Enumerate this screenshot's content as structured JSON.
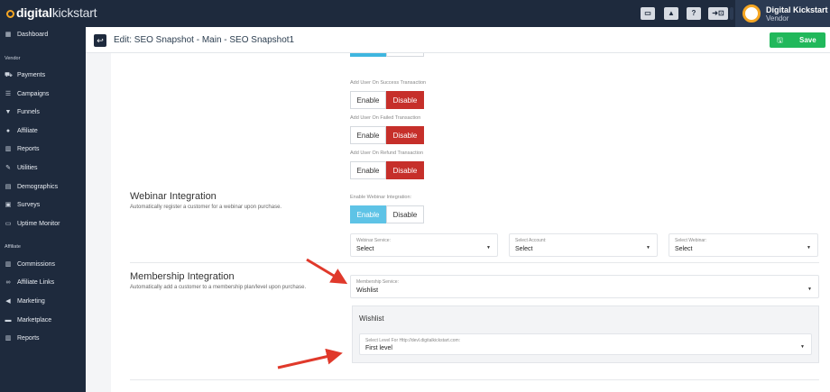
{
  "brand": {
    "logo_bold": "digital",
    "logo_light": "kickstart"
  },
  "topbar": {
    "buttons": [
      "▭",
      "▲",
      "?",
      "➜⊡",
      "●+"
    ],
    "user_name": "Digital Kickstart",
    "user_role": "Vendor"
  },
  "sidebar": {
    "top": [
      {
        "label": "Dashboard",
        "icon": "grid-icon"
      }
    ],
    "vendor_section": "Vendor",
    "vendor_items": [
      {
        "label": "Payments",
        "icon": "cart-icon"
      },
      {
        "label": "Campaigns",
        "icon": "list-icon"
      },
      {
        "label": "Funnels",
        "icon": "filter-icon"
      },
      {
        "label": "Affiliate",
        "icon": "user-icon"
      },
      {
        "label": "Reports",
        "icon": "bar-chart-icon"
      },
      {
        "label": "Utilities",
        "icon": "wrench-icon"
      },
      {
        "label": "Demographics",
        "icon": "area-chart-icon"
      },
      {
        "label": "Surveys",
        "icon": "clipboard-icon"
      },
      {
        "label": "Uptime Monitor",
        "icon": "monitor-icon"
      }
    ],
    "affiliate_section": "Affiliate",
    "affiliate_items": [
      {
        "label": "Commissions",
        "icon": "bar-chart-icon"
      },
      {
        "label": "Affiliate Links",
        "icon": "link-icon"
      },
      {
        "label": "Marketing",
        "icon": "megaphone-icon"
      },
      {
        "label": "Marketplace",
        "icon": "store-icon"
      },
      {
        "label": "Reports",
        "icon": "bar-chart-icon"
      }
    ]
  },
  "header": {
    "title": "Edit: SEO Snapshot - Main - SEO Snapshot1",
    "save_label": "Save",
    "back_icon": "↩",
    "save_icon": "🖫"
  },
  "toggles": [
    {
      "label": "Add User On Success Transaction",
      "enable": "Enable",
      "disable": "Disable",
      "selected": "disable"
    },
    {
      "label": "Add User On Failed Transaction",
      "enable": "Enable",
      "disable": "Disable",
      "selected": "disable"
    },
    {
      "label": "Add User On Refund Transaction",
      "enable": "Enable",
      "disable": "Disable",
      "selected": "disable"
    }
  ],
  "webinar": {
    "title": "Webinar Integration",
    "description": "Automatically register a customer for a webinar upon purchase.",
    "enable_label": "Enable Webinar Integration:",
    "enable": "Enable",
    "disable": "Disable",
    "selected": "enable",
    "service_label": "Webinar Service:",
    "service_value": "Select",
    "account_label": "Select Account:",
    "account_value": "Select",
    "select_webinar_label": "Select Webinar:",
    "select_webinar_value": "Select"
  },
  "membership": {
    "title": "Membership Integration",
    "description": "Automatically add a customer to a membership plan/level upon purchase.",
    "service_label": "Membership Service:",
    "service_value": "Wishlist",
    "box_title": "Wishlist",
    "level_label": "Select Level For Http://devl.digitalkickstart.com:",
    "level_value": "First level"
  },
  "colors": {
    "sidebar": "#1e2a3d",
    "save": "#21b85b",
    "disable_active": "#c62f2a",
    "enable_active": "#5ec3e6",
    "arrow": "#e0392b"
  }
}
